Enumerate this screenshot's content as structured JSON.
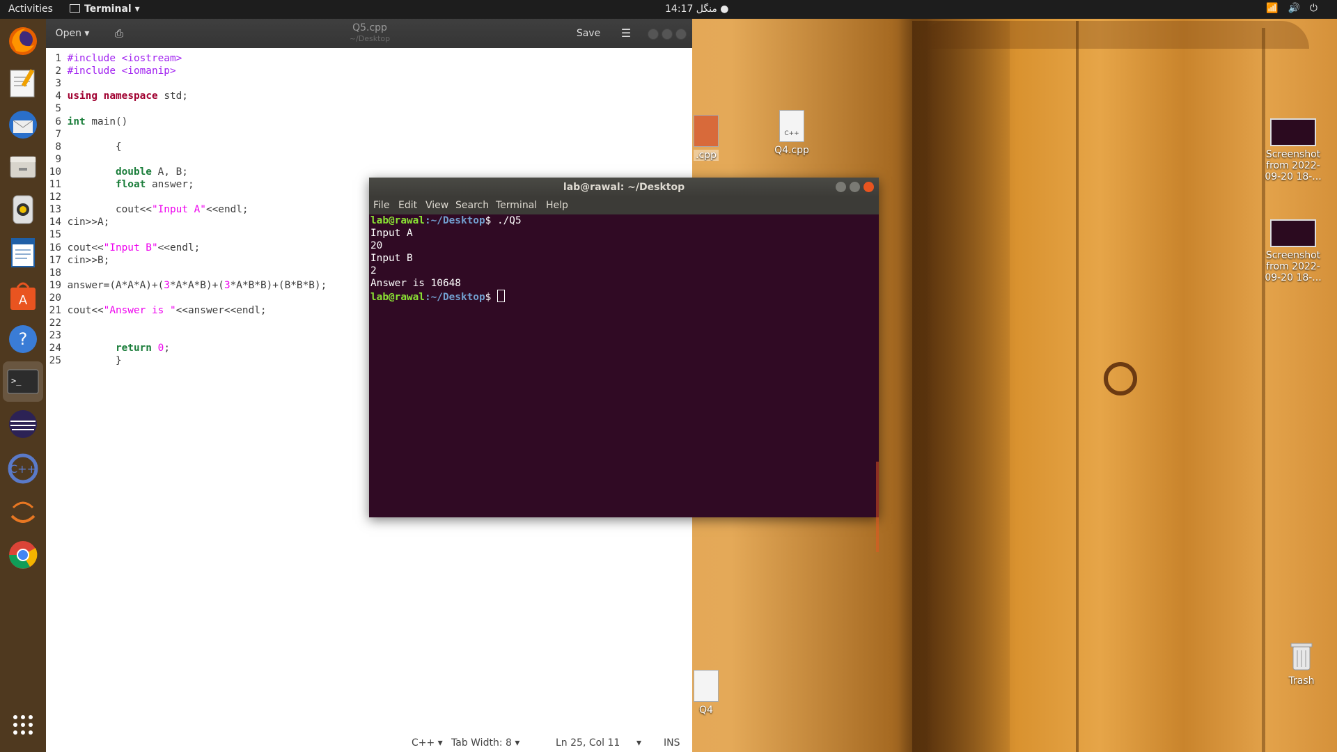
{
  "topbar": {
    "activities": "Activities",
    "app_menu": "Terminal ▾",
    "clock": "14:17 منگل ●",
    "tray_icons": [
      "wifi-icon",
      "volume-icon",
      "power-icon"
    ]
  },
  "dock": {
    "items": [
      "firefox",
      "text-editor",
      "thunderbird",
      "files",
      "rhythmbox",
      "libreoffice-writer",
      "software",
      "help",
      "terminal",
      "eclipse",
      "codeblocks",
      "netbeans",
      "chrome",
      "show-apps"
    ]
  },
  "gedit": {
    "open_label": "Open ▾",
    "title": "Q5.cpp",
    "subtitle": "~/Desktop",
    "save_label": "Save",
    "menu_label": "☰",
    "lines": [
      {
        "n": "1",
        "text": "#include <iostream>"
      },
      {
        "n": "2",
        "text": "#include <iomanip>"
      },
      {
        "n": "3",
        "text": ""
      },
      {
        "n": "4",
        "text": "using namespace std;"
      },
      {
        "n": "5",
        "text": ""
      },
      {
        "n": "6",
        "text": "int main()"
      },
      {
        "n": "7",
        "text": ""
      },
      {
        "n": "8",
        "text": "        {"
      },
      {
        "n": "9",
        "text": ""
      },
      {
        "n": "10",
        "text": "        double A, B;"
      },
      {
        "n": "11",
        "text": "        float answer;"
      },
      {
        "n": "12",
        "text": ""
      },
      {
        "n": "13",
        "text": "        cout<<\"Input A\"<<endl;"
      },
      {
        "n": "14",
        "text": "cin>>A;"
      },
      {
        "n": "15",
        "text": ""
      },
      {
        "n": "16",
        "text": "cout<<\"Input B\"<<endl;"
      },
      {
        "n": "17",
        "text": "cin>>B;"
      },
      {
        "n": "18",
        "text": ""
      },
      {
        "n": "19",
        "text": "answer=(A*A*A)+(3*A*A*B)+(3*A*B*B)+(B*B*B);"
      },
      {
        "n": "20",
        "text": ""
      },
      {
        "n": "21",
        "text": "cout<<\"Answer is \"<<answer<<endl;"
      },
      {
        "n": "22",
        "text": ""
      },
      {
        "n": "23",
        "text": ""
      },
      {
        "n": "24",
        "text": "        return 0;"
      },
      {
        "n": "25",
        "text": "        }"
      }
    ],
    "status": {
      "language": "C++ ▾",
      "tab_width": "Tab Width: 8 ▾",
      "position": "Ln 25, Col 11",
      "mode_arrow": "▾",
      "ins": "INS"
    }
  },
  "desktop": {
    "icons": {
      "q4cpp": "Q4.cpp",
      "cpp_partial": ".cpp",
      "screenshot1": "Screenshot from 2022-09-20 18-...",
      "screenshot2": "Screenshot from 2022-09-20 18-...",
      "q4": "Q4",
      "trash": "Trash",
      "cpp_glyph": "C++"
    }
  },
  "terminal": {
    "title": "lab@rawal: ~/Desktop",
    "menu": [
      "File",
      "Edit",
      "View",
      "Search",
      "Terminal",
      "Help"
    ],
    "prompt_user": "lab@rawal",
    "prompt_path": ":~/Desktop",
    "prompt_symbol": "$",
    "command": " ./Q5",
    "output": [
      "Input A",
      "20",
      "Input B",
      "2",
      "Answer is 10648"
    ]
  }
}
